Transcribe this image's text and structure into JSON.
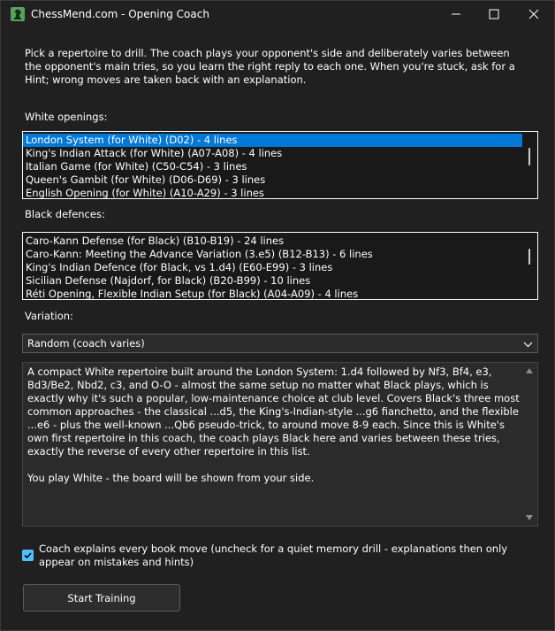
{
  "window": {
    "title": "ChessMend.com - Opening Coach",
    "app_icon": "chess-knight-icon"
  },
  "intro": "Pick a repertoire to drill. The coach plays your opponent's side and deliberately varies between the opponent's main tries, so you learn the right reply to each one. When you're stuck, ask for a Hint; wrong moves are taken back with an explanation.",
  "white_openings": {
    "label": "White openings:",
    "items": [
      "London System (for White)  (D02)  -  4 lines",
      "King's Indian Attack (for White)  (A07-A08)  -  4 lines",
      "Italian Game (for White)  (C50-C54)  -  3 lines",
      "Queen's Gambit (for White)  (D06-D69)  -  3 lines",
      "English Opening (for White)  (A10-A29)  -  3 lines"
    ],
    "selected_index": 0
  },
  "black_defences": {
    "label": "Black defences:",
    "items": [
      "Caro-Kann Defense (for Black)  (B10-B19)  -  24 lines",
      "Caro-Kann: Meeting the Advance Variation (3.e5)  (B12-B13)  -  6 lines",
      "King's Indian Defence (for Black, vs 1.d4)  (E60-E99)  -  3 lines",
      "Sicilian Defense (Najdorf, for Black)  (B20-B99)  -  10 lines",
      "Réti Opening, Flexible Indian Setup (for Black)  (A04-A09)  -  4 lines"
    ]
  },
  "variation": {
    "label": "Variation:",
    "selected": "Random (coach varies)"
  },
  "description": {
    "paragraphs": [
      "A compact White repertoire built around the London System: 1.d4 followed by Nf3, Bf4, e3, Bd3/Be2, Nbd2, c3, and O-O - almost the same setup no matter what Black plays, which is exactly why it's such a popular, low-maintenance choice at club level. Covers Black's three most common approaches - the classical ...d5, the King's-Indian-style ...g6 fianchetto, and the flexible ...e6 - plus the well-known ...Qb6 pseudo-trick, to around move 8-9 each. Since this is White's own first repertoire in this coach, the coach plays Black here and varies between these tries, exactly the reverse of every other repertoire in this list.",
      "You play White - the board will be shown from your side."
    ]
  },
  "explain_checkbox": {
    "checked": true,
    "label": "Coach explains every book move (uncheck for a quiet memory drill - explanations then only appear on mistakes and hints)"
  },
  "start_button": "Start Training",
  "colors": {
    "background": "#202020",
    "selection": "#0078d7",
    "checkbox_accent": "#4cc2ff"
  }
}
